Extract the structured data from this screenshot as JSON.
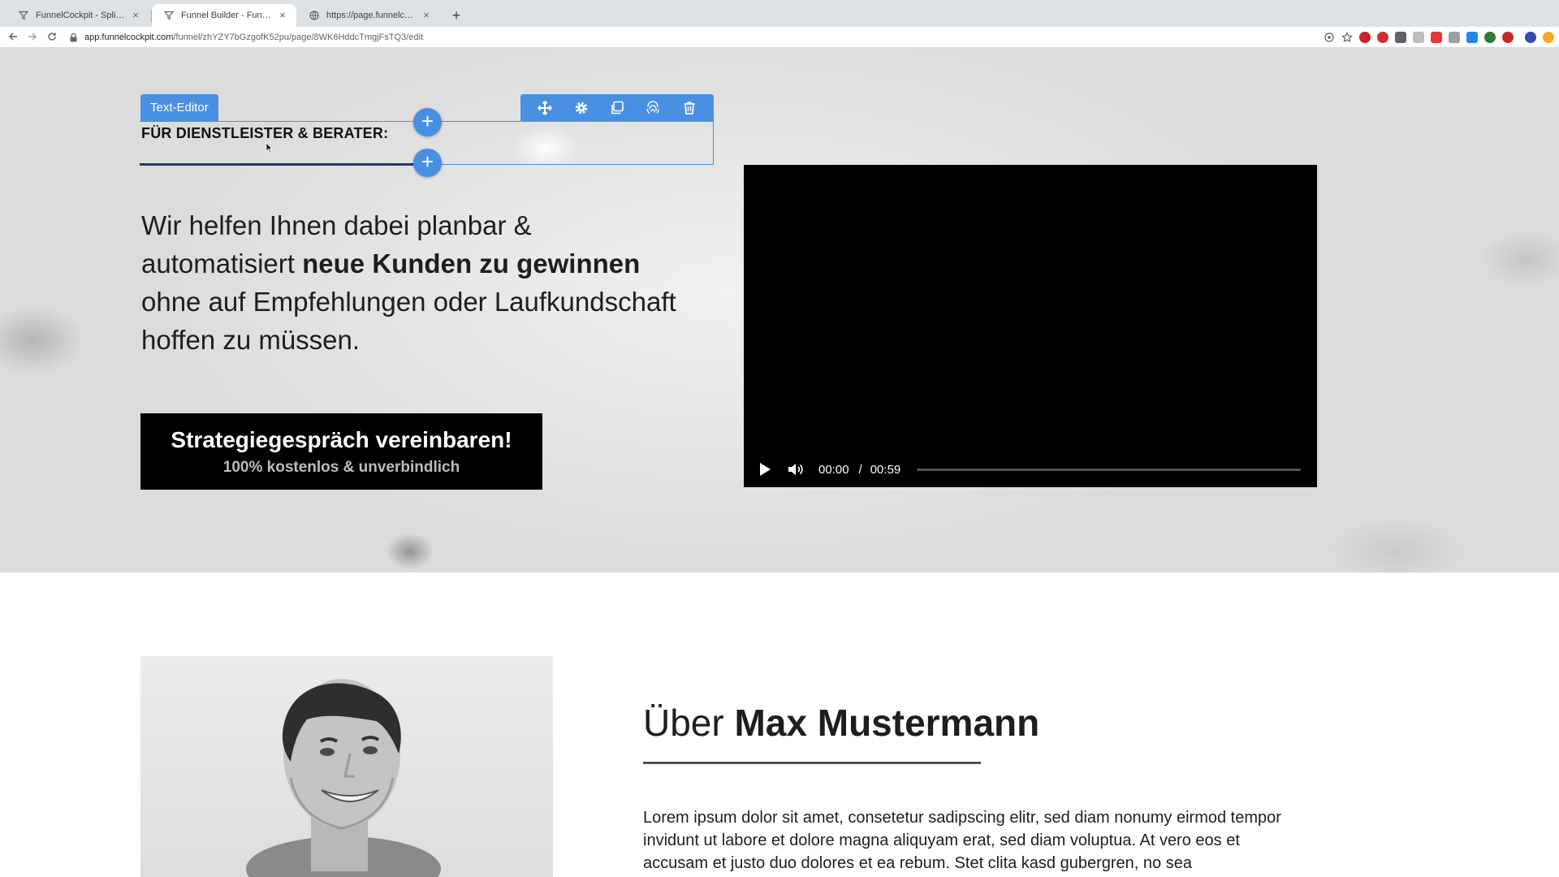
{
  "browser": {
    "tabs": [
      {
        "title": "FunnelCockpit - Splittests, Ma",
        "active": false,
        "icon": "funnel-icon"
      },
      {
        "title": "Funnel Builder - FunnelCockpit",
        "active": true,
        "icon": "funnel-icon"
      },
      {
        "title": "https://page.funnelcockpit.com",
        "active": false,
        "icon": "globe-icon"
      }
    ],
    "tab_close": "×",
    "new_tab": "+",
    "url_host": "app.funnelcockpit.com",
    "url_path": "/funnel/zhYZY7bGzgofK52pu/page/8WK6HddcTmgjFsTQ3/edit"
  },
  "editor": {
    "label": "Text-Editor",
    "heading": "FÜR DIENSTLEISTER & BERATER:",
    "add_symbol": "+",
    "accent_color": "#4a90e2"
  },
  "hero": {
    "text_1": "Wir helfen Ihnen dabei planbar &",
    "text_2": "automatisiert ",
    "text_bold": "neue Kunden zu gewinnen",
    "text_3": "ohne auf Empfehlungen oder Laufkundschaft",
    "text_4": "hoffen zu müssen.",
    "cta_main": "Strategiegespräch vereinbaren!",
    "cta_sub": "100% kostenlos & unverbindlich"
  },
  "video": {
    "current_time": "00:00",
    "separator": "/",
    "duration": "00:59",
    "progress": 0
  },
  "about": {
    "title_plain": "Über ",
    "title_bold": "Max Mustermann",
    "body": "Lorem ipsum dolor sit amet, consetetur sadipscing elitr, sed diam nonumy eirmod tempor invidunt ut labore et dolore magna aliquyam erat, sed diam voluptua. At vero eos et accusam et justo duo dolores et ea rebum. Stet clita kasd gubergren, no sea"
  }
}
